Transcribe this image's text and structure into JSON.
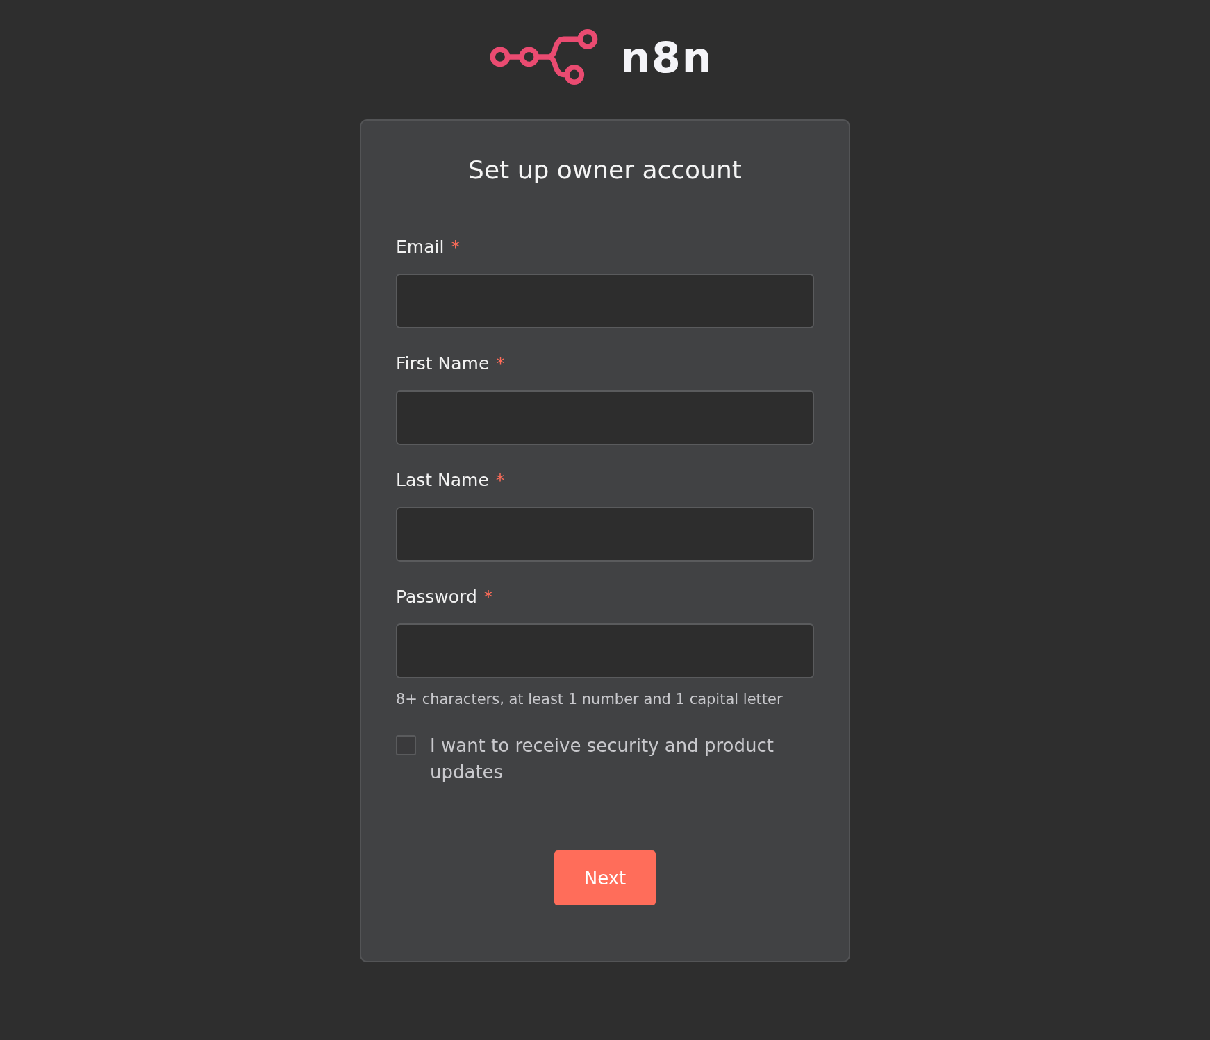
{
  "logo": {
    "text": "n8n"
  },
  "card": {
    "title": "Set up owner account",
    "fields": [
      {
        "label": "Email",
        "required_mark": "*"
      },
      {
        "label": "First Name",
        "required_mark": "*"
      },
      {
        "label": "Last Name",
        "required_mark": "*"
      },
      {
        "label": "Password",
        "required_mark": "*",
        "hint": "8+ characters, at least 1 number and 1 capital letter"
      }
    ],
    "checkbox": {
      "label": "I want to receive security and product updates",
      "checked": false
    },
    "button": {
      "label": "Next"
    }
  }
}
